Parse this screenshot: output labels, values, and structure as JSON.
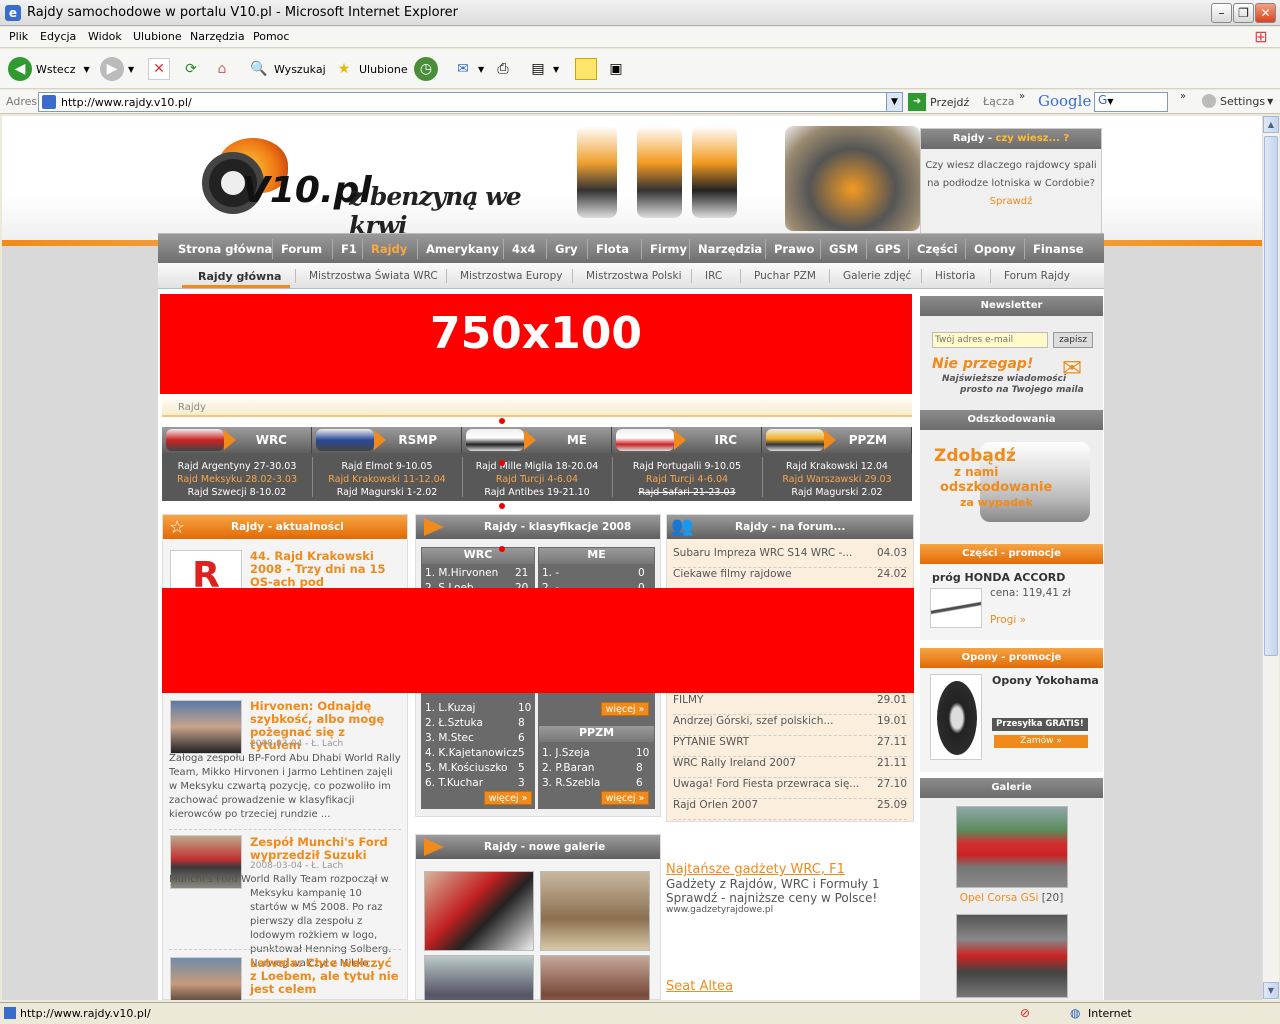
{
  "window": {
    "title": "Rajdy samochodowe w portalu V10.pl - Microsoft Internet Explorer"
  },
  "menu": [
    "Plik",
    "Edycja",
    "Widok",
    "Ulubione",
    "Narzędzia",
    "Pomoc"
  ],
  "toolbar": {
    "back": "Wstecz",
    "search": "Wyszukaj",
    "favorites": "Ulubione"
  },
  "address": {
    "label": "Adres",
    "url": "http://www.rajdy.v10.pl/",
    "go": "Przejdź",
    "links": "Łącza",
    "google": "Google",
    "google_g": "G",
    "settings": "Settings"
  },
  "status": {
    "text": "http://www.rajdy.v10.pl/",
    "zone": "Internet"
  },
  "site": {
    "logo": "V10.pl",
    "tagline": "z benzyną we krwi",
    "didyou": {
      "head": "Rajdy - ",
      "head_hl": "czy wiesz... ?",
      "text": "Czy wiesz dlaczego rajdowcy spali na podłodze lotniska w Cordobie?",
      "link": "Sprawdź"
    },
    "nav1": [
      "Strona główna",
      "Forum",
      "F1",
      "Rajdy",
      "Amerykany",
      "4x4",
      "Gry",
      "Flota",
      "Firmy",
      "Narzędzia",
      "Prawo",
      "GSM",
      "GPS",
      "Części",
      "Opony",
      "Finanse"
    ],
    "nav2": [
      "Rajdy główna",
      "Mistrzostwa Świata WRC",
      "Mistrzostwa Europy",
      "Mistrzostwa Polski",
      "IRC",
      "Puchar PZM",
      "Galerie zdjęć",
      "Historia",
      "Forum Rajdy"
    ],
    "ad_top": "750x100",
    "crumb": "Rajdy",
    "champs": [
      {
        "name": "WRC",
        "rows": [
          {
            "t": "Rajd Argentyny 27-30.03",
            "c": "w"
          },
          {
            "t": "Rajd Meksyku 28.02-3.03",
            "c": "o"
          },
          {
            "t": "Rajd Szwecji 8-10.02",
            "c": "w"
          }
        ]
      },
      {
        "name": "RSMP",
        "rows": [
          {
            "t": "Rajd Elmot 9-10.05",
            "c": "w"
          },
          {
            "t": "Rajd Krakowski 11-12.04",
            "c": "o"
          },
          {
            "t": "Rajd Magurski 1-2.02",
            "c": "w"
          }
        ]
      },
      {
        "name": "ME",
        "rows": [
          {
            "t": "Rajd Mille Miglia 18-20.04",
            "c": "w"
          },
          {
            "t": "Rajd Turcji 4-6.04",
            "c": "o"
          },
          {
            "t": "Rajd Antibes 19-21.10",
            "c": "w"
          }
        ]
      },
      {
        "name": "IRC",
        "rows": [
          {
            "t": "Rajd Portugalii 9-10.05",
            "c": "w"
          },
          {
            "t": "Rajd Turcji 4-6.04",
            "c": "o"
          },
          {
            "t": "Rajd Safari 21-23.03",
            "c": "s"
          }
        ]
      },
      {
        "name": "PPZM",
        "rows": [
          {
            "t": "Rajd Krakowski 12.04",
            "c": "w"
          },
          {
            "t": "Rajd Warszawski 29.03",
            "c": "o"
          },
          {
            "t": "Rajd Magurski 2.02",
            "c": "w"
          }
        ]
      }
    ],
    "news": {
      "head": "Rajdy - aktualności",
      "items": [
        {
          "title": "44. Rajd Krakowski 2008 - Trzy dni na 15 OS-ach pod Myślenicami",
          "date": "",
          "text": ""
        },
        {
          "title": "Hirvonen: Odnajdę szybkość, albo mogę pożegnać się z tytułem",
          "date": "2008-03-04 - Ł. Lach",
          "text": "Załoga zespołu BP-Ford Abu Dhabi World Rally Team, Mikko Hirvonen i Jarmo Lehtinen zajęli w Meksyku czwartą pozycję, co pozwoliło im zachować prowadzenie w klasyfikacji kierowców po trzeciej rundzie ..."
        },
        {
          "title": "Zespół Munchi's Ford wyprzedził Suzuki",
          "date": "2008-03-04 - Ł. Lach",
          "text": "Munchi's Ford World Rally Team rozpoczął w Meksyku kampanię 10 startów w MŚ 2008. Po raz pierwszy dla zespołu z lodowym rożkiem w logo, punktował Henning Solberg. Norweg walczył z Mikko ..."
        },
        {
          "title": "Latvala: Chce walczyć z Loebem, ale tytuł nie jest celem",
          "date": "",
          "text": ""
        }
      ]
    },
    "class": {
      "head": "Rajdy - klasyfikacje 2008",
      "wrc": {
        "name": "WRC",
        "rows": [
          [
            "1. M.Hirvonen",
            "21"
          ],
          [
            "2. S.Loeb",
            "20"
          ]
        ]
      },
      "me": {
        "name": "ME",
        "rows": [
          [
            "1. -",
            "0"
          ],
          [
            "2. -",
            "0"
          ]
        ]
      },
      "rsmp": {
        "rows": [
          [
            "1. L.Kuzaj",
            "10"
          ],
          [
            "2. Ł.Sztuka",
            "8"
          ],
          [
            "3. M.Stec",
            "6"
          ],
          [
            "4. K.Kajetanowicz",
            "5"
          ],
          [
            "5. M.Kościuszko",
            "5"
          ],
          [
            "6. T.Kuchar",
            "3"
          ]
        ]
      },
      "ppzm": {
        "name": "PPZM",
        "rows": [
          [
            "1. J.Szeja",
            "10"
          ],
          [
            "2. P.Baran",
            "8"
          ],
          [
            "3. R.Szebla",
            "6"
          ]
        ]
      },
      "more": "więcej »"
    },
    "forum": {
      "head": "Rajdy - na forum...",
      "rows": [
        [
          "Subaru Impreza WRC S14 WRC -...",
          "04.03"
        ],
        [
          "Ciekawe filmy rajdowe",
          "24.02"
        ],
        [
          "FILMY",
          "29.01"
        ],
        [
          "Andrzej Górski, szef polskich...",
          "19.01"
        ],
        [
          "PYTANIE SWRT",
          "27.11"
        ],
        [
          "WRC Rally Ireland 2007",
          "21.11"
        ],
        [
          "Uwaga! Ford Fiesta przewraca się...",
          "27.10"
        ],
        [
          "Rajd Orlen 2007",
          "25.09"
        ]
      ]
    },
    "galleries": {
      "head": "Rajdy - nowe galerie"
    },
    "ads": [
      {
        "title": "Najtańsze gadżety WRC, F1",
        "text": "Gadżety z Rajdów, WRC i Formuły 1 Sprawdź - najniższe ceny w Polsce!",
        "url": "www.gadzetyrajdowe.pl"
      },
      {
        "title": "Seat Altea",
        "text": "",
        "url": ""
      }
    ],
    "newsletter": {
      "head": "Newsletter",
      "placeholder": "Twój adres e-mail",
      "button": "zapisz",
      "promo1": "Nie przegap!",
      "promo2": "Najświeższe wiadomości",
      "promo3": "prosto na Twojego maila"
    },
    "odsz": {
      "head": "Odszkodowania",
      "line1": "Zdobądź",
      "line2": "z nami",
      "line3": "odszkodowanie",
      "line4": "za wypadek"
    },
    "parts": {
      "head": "Części - promocje",
      "name": "próg HONDA ACCORD",
      "price_label": "cena:",
      "price": "119,41 zł",
      "link": "Progi »"
    },
    "tires": {
      "head": "Opony - promocje",
      "name": "Opony Yokohama",
      "ship": "Przesyłka GRATIS!",
      "order": "Zamów »"
    },
    "gallery": {
      "head": "Galerie",
      "items": [
        {
          "name": "Opel Corsa GSi",
          "count": "[20]"
        }
      ]
    }
  },
  "colors": {
    "accent": "#f08a1a",
    "ad_red": "#ff0000",
    "nav_grey": "#7a7a7a"
  }
}
